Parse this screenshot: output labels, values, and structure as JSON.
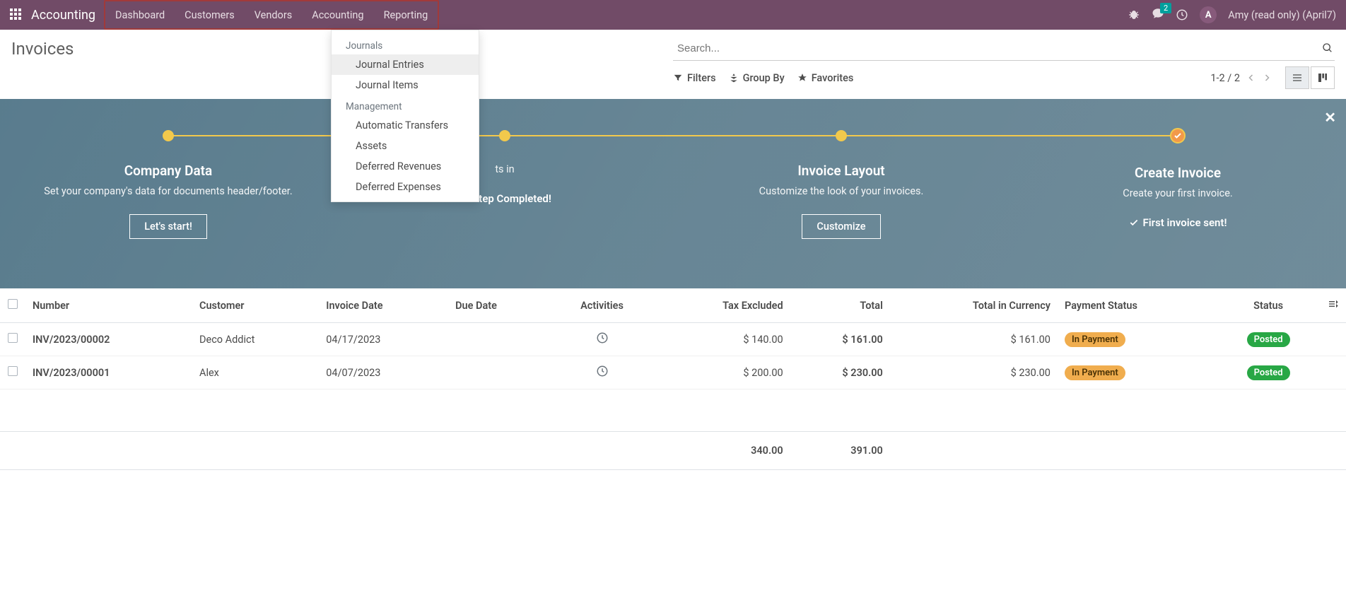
{
  "nav": {
    "app": "Accounting",
    "items": [
      "Dashboard",
      "Customers",
      "Vendors",
      "Accounting",
      "Reporting"
    ],
    "msg_count": "2",
    "avatar_letter": "A",
    "user": "Amy (read only) (April7)"
  },
  "dropdown": {
    "section1": "Journals",
    "items1": [
      "Journal Entries",
      "Journal Items"
    ],
    "section2": "Management",
    "items2": [
      "Automatic Transfers",
      "Assets",
      "Deferred Revenues",
      "Deferred Expenses"
    ]
  },
  "breadcrumb": "Invoices",
  "search": {
    "placeholder": "Search..."
  },
  "toolbar": {
    "filters": "Filters",
    "group": "Group By",
    "favorites": "Favorites",
    "pager": "1-2 / 2"
  },
  "onboard": {
    "steps": [
      {
        "title": "Company Data",
        "desc": "Set your company's data for documents header/footer.",
        "action": "Let's start!",
        "type": "button"
      },
      {
        "title": "",
        "desc": "ts in",
        "action": "Step Completed!",
        "type": "done"
      },
      {
        "title": "Invoice Layout",
        "desc": "Customize the look of your invoices.",
        "action": "Customize",
        "type": "button"
      },
      {
        "title": "Create Invoice",
        "desc": "Create your first invoice.",
        "action": "First invoice sent!",
        "type": "done"
      }
    ]
  },
  "table": {
    "headers": {
      "number": "Number",
      "customer": "Customer",
      "invoice_date": "Invoice Date",
      "due_date": "Due Date",
      "activities": "Activities",
      "tax_excluded": "Tax Excluded",
      "total": "Total",
      "total_currency": "Total in Currency",
      "payment_status": "Payment Status",
      "status": "Status"
    },
    "rows": [
      {
        "number": "INV/2023/00002",
        "customer": "Deco Addict",
        "invoice_date": "04/17/2023",
        "tax": "$ 140.00",
        "total": "$ 161.00",
        "currency": "$ 161.00",
        "payment": "In Payment",
        "status": "Posted"
      },
      {
        "number": "INV/2023/00001",
        "customer": "Alex",
        "invoice_date": "04/07/2023",
        "tax": "$ 200.00",
        "total": "$ 230.00",
        "currency": "$ 230.00",
        "payment": "In Payment",
        "status": "Posted"
      }
    ],
    "footer": {
      "tax": "340.00",
      "total": "391.00"
    }
  }
}
